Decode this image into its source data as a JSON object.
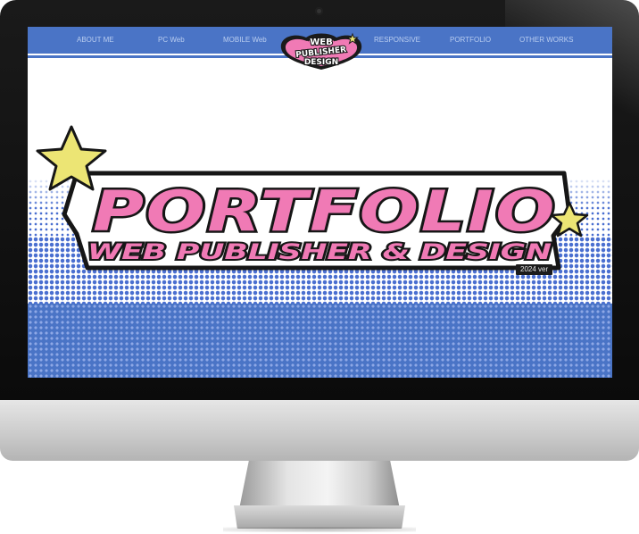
{
  "nav": {
    "items": [
      "ABOUT ME",
      "PC Web",
      "MOBILE Web",
      "RESPONSIVE",
      "PORTFOLIO",
      "OTHER WORKS"
    ]
  },
  "logo": {
    "line1": "WEB",
    "line2": "PUBLISHER",
    "line3": "DESIGN"
  },
  "hero": {
    "title": "PORTFOLIO",
    "subtitle": "WEB PUBLISHER & DESIGN",
    "version": "2024 ver"
  },
  "colors": {
    "nav_blue": "#4a74c6",
    "title_pink": "#f07ab5",
    "star_yellow": "#ece574",
    "outline": "#161616"
  }
}
